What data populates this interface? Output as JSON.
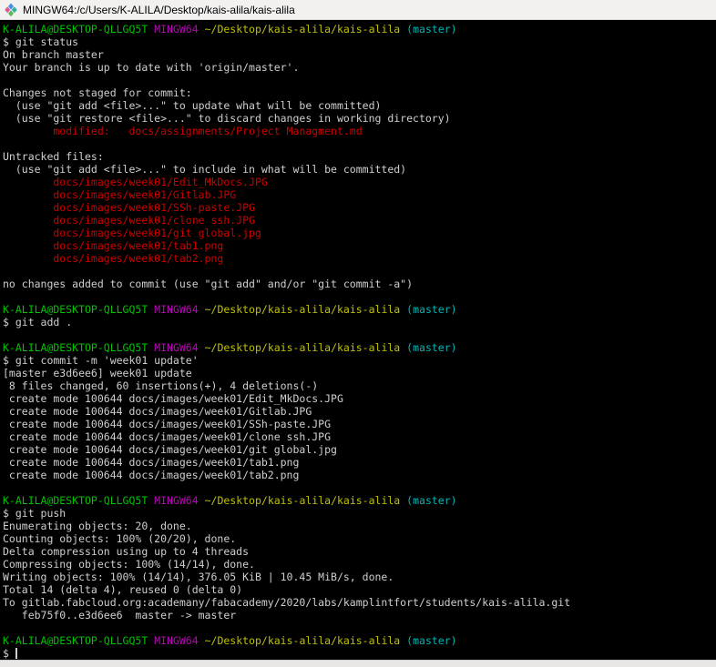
{
  "window": {
    "title": "MINGW64:/c/Users/K-ALILA/Desktop/kais-alila/kais-alila",
    "icon": "mingw-diamond-icon"
  },
  "colors": {
    "fg": "#cfcfcf",
    "green": "#00c200",
    "magenta": "#c000c0",
    "yellow": "#c0c000",
    "cyan": "#00b5b5",
    "red": "#cd0000",
    "cursor": "#cfcfcf",
    "background": "#000000",
    "titlebar_bg": "#f2f1f0",
    "title_fg": "#000000"
  },
  "prompt": {
    "user_host": "K-ALILA@DESKTOP-QLLGQ5T",
    "environment": "MINGW64",
    "path": "~/Desktop/kais-alila/kais-alila",
    "branch": "(master)"
  },
  "terminal": {
    "lines": [
      "prompt",
      [
        {
          "t": "$ git status",
          "c": "fg"
        }
      ],
      [
        {
          "t": "On branch master",
          "c": "fg"
        }
      ],
      [
        {
          "t": "Your branch is up to date with 'origin/master'.",
          "c": "fg"
        }
      ],
      [],
      [
        {
          "t": "Changes not staged for commit:",
          "c": "fg"
        }
      ],
      [
        {
          "t": "  (use \"git add <file>...\" to update what will be committed)",
          "c": "fg"
        }
      ],
      [
        {
          "t": "  (use \"git restore <file>...\" to discard changes in working directory)",
          "c": "fg"
        }
      ],
      [
        {
          "t": "        modified:   docs/assignments/Project Managment.md",
          "c": "red"
        }
      ],
      [],
      [
        {
          "t": "Untracked files:",
          "c": "fg"
        }
      ],
      [
        {
          "t": "  (use \"git add <file>...\" to include in what will be committed)",
          "c": "fg"
        }
      ],
      [
        {
          "t": "        docs/images/week01/Edit_MkDocs.JPG",
          "c": "red"
        }
      ],
      [
        {
          "t": "        docs/images/week01/Gitlab.JPG",
          "c": "red"
        }
      ],
      [
        {
          "t": "        docs/images/week01/SSh-paste.JPG",
          "c": "red"
        }
      ],
      [
        {
          "t": "        docs/images/week01/clone ssh.JPG",
          "c": "red"
        }
      ],
      [
        {
          "t": "        docs/images/week01/git global.jpg",
          "c": "red"
        }
      ],
      [
        {
          "t": "        docs/images/week01/tab1.png",
          "c": "red"
        }
      ],
      [
        {
          "t": "        docs/images/week01/tab2.png",
          "c": "red"
        }
      ],
      [],
      [
        {
          "t": "no changes added to commit (use \"git add\" and/or \"git commit -a\")",
          "c": "fg"
        }
      ],
      [],
      "prompt",
      [
        {
          "t": "$ git add .",
          "c": "fg"
        }
      ],
      [],
      "prompt",
      [
        {
          "t": "$ git commit -m 'week01 update'",
          "c": "fg"
        }
      ],
      [
        {
          "t": "[master e3d6ee6] week01 update",
          "c": "fg"
        }
      ],
      [
        {
          "t": " 8 files changed, 60 insertions(+), 4 deletions(-)",
          "c": "fg"
        }
      ],
      [
        {
          "t": " create mode 100644 docs/images/week01/Edit_MkDocs.JPG",
          "c": "fg"
        }
      ],
      [
        {
          "t": " create mode 100644 docs/images/week01/Gitlab.JPG",
          "c": "fg"
        }
      ],
      [
        {
          "t": " create mode 100644 docs/images/week01/SSh-paste.JPG",
          "c": "fg"
        }
      ],
      [
        {
          "t": " create mode 100644 docs/images/week01/clone ssh.JPG",
          "c": "fg"
        }
      ],
      [
        {
          "t": " create mode 100644 docs/images/week01/git global.jpg",
          "c": "fg"
        }
      ],
      [
        {
          "t": " create mode 100644 docs/images/week01/tab1.png",
          "c": "fg"
        }
      ],
      [
        {
          "t": " create mode 100644 docs/images/week01/tab2.png",
          "c": "fg"
        }
      ],
      [],
      "prompt",
      [
        {
          "t": "$ git push",
          "c": "fg"
        }
      ],
      [
        {
          "t": "Enumerating objects: 20, done.",
          "c": "fg"
        }
      ],
      [
        {
          "t": "Counting objects: 100% (20/20), done.",
          "c": "fg"
        }
      ],
      [
        {
          "t": "Delta compression using up to 4 threads",
          "c": "fg"
        }
      ],
      [
        {
          "t": "Compressing objects: 100% (14/14), done.",
          "c": "fg"
        }
      ],
      [
        {
          "t": "Writing objects: 100% (14/14), 376.05 KiB | 10.45 MiB/s, done.",
          "c": "fg"
        }
      ],
      [
        {
          "t": "Total 14 (delta 4), reused 0 (delta 0)",
          "c": "fg"
        }
      ],
      [
        {
          "t": "To gitlab.fabcloud.org:academany/fabacademy/2020/labs/kamplintfort/students/kais-alila.git",
          "c": "fg"
        }
      ],
      [
        {
          "t": "   feb75f0..e3d6ee6  master -> master",
          "c": "fg"
        }
      ],
      [],
      "prompt",
      [
        {
          "t": "$ ",
          "c": "fg"
        },
        {
          "cursor": true
        }
      ]
    ]
  }
}
